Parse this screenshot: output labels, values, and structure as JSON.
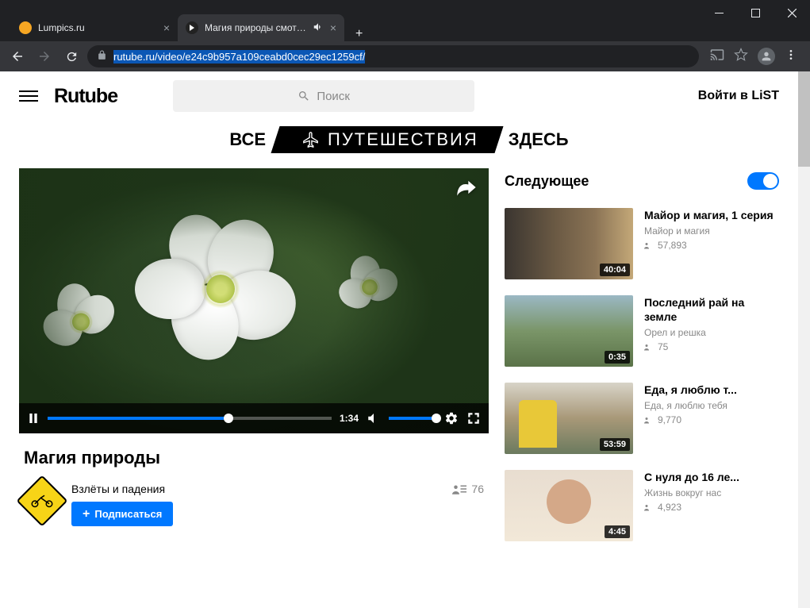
{
  "browser": {
    "tabs": [
      {
        "title": "Lumpics.ru",
        "favicon_color": "#f6a623",
        "active": false
      },
      {
        "title": "Магия природы смотреть о",
        "favicon_type": "play",
        "active": true,
        "muted_icon": true
      }
    ],
    "url_prefix": "rutube.ru",
    "url_path": "/video/e24c9b957a109ceabd0cec29ec1259cf/"
  },
  "header": {
    "logo": "Rutube",
    "search_placeholder": "Поиск",
    "login_label": "Войти в LiST"
  },
  "promo": {
    "left": "ВСЕ",
    "center": "ПУТЕШЕСТВИЯ",
    "right": "ЗДЕСЬ"
  },
  "player": {
    "current_time": "1:34",
    "progress_percent": 62,
    "volume_percent": 90
  },
  "video": {
    "title": "Магия природы",
    "channel": "Взлёты и падения",
    "subscribe_label": "Подписаться",
    "views": "76"
  },
  "sidebar": {
    "next_label": "Следующее",
    "autoplay_on": true,
    "items": [
      {
        "title": "Майор и магия, 1 серия",
        "channel": "Майор и магия",
        "views": "57,893",
        "duration": "40:04"
      },
      {
        "title": "Последний рай на земле",
        "channel": "Орел и решка",
        "views": "75",
        "duration": "0:35"
      },
      {
        "title": "Еда, я люблю т...",
        "channel": "Еда, я люблю тебя",
        "views": "9,770",
        "duration": "53:59"
      },
      {
        "title": "С нуля до 16 ле...",
        "channel": "Жизнь вокруг нас",
        "views": "4,923",
        "duration": "4:45"
      }
    ]
  }
}
